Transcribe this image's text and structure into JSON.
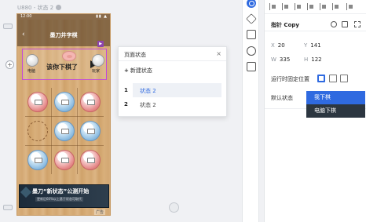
{
  "artboard": {
    "name": "U880 - 状态 2"
  },
  "phone": {
    "status_time": "12:00",
    "status_icons": "▮▮ ▲",
    "nav_title": "墨刀井字棋",
    "back_glyph": "‹",
    "play_glyph": "▶",
    "player_left": "电脑",
    "player_right": "玩家",
    "turn_text": "该你下棋了",
    "banner_text": "墨刀“新状态”公测开始",
    "banner_sub": "更新后60%以上基于状态可取代",
    "ad_label": "广告"
  },
  "board": {
    "cells": [
      "pink",
      "blue",
      "pink",
      "empty",
      "blue",
      "blue",
      "blue",
      "pink",
      "pink"
    ]
  },
  "popup": {
    "title": "页面状态",
    "close_glyph": "×",
    "new_state_plus": "+",
    "new_state_label": "新建状态",
    "states": [
      {
        "num": "1",
        "name": "状态 2"
      },
      {
        "num": "2",
        "name": "状态 2"
      }
    ]
  },
  "panel": {
    "layer_name": "指针 Copy",
    "x_label": "X",
    "x_value": "20",
    "y_label": "Y",
    "y_value": "141",
    "w_label": "W",
    "w_value": "335",
    "h_label": "H",
    "h_value": "122",
    "fixed_position_label": "运行时固定位置",
    "default_label": "默认状态",
    "options": [
      "我下棋",
      "电脑下棋"
    ]
  },
  "colors": {
    "accent": "#2f6ae0",
    "selection": "#c24bd8",
    "dropdown_dark": "#2c3640"
  }
}
